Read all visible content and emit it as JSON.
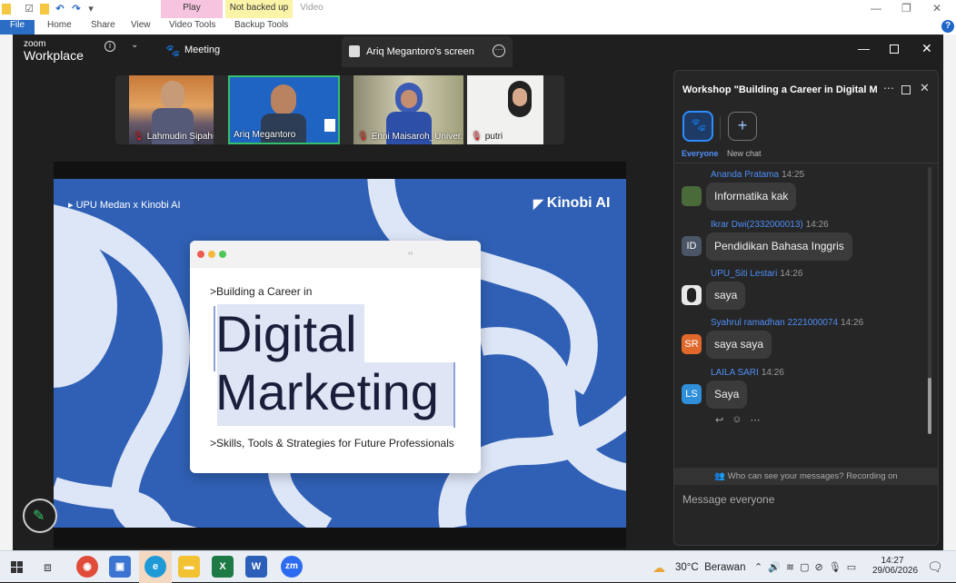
{
  "office": {
    "ribbon_contexts": [
      {
        "label": "Play",
        "color": "#f6c4df"
      },
      {
        "label": "Not backed up",
        "color": "#fbf3a8"
      },
      {
        "label": "Video",
        "color": "#ffffff"
      }
    ],
    "tabs": [
      "File",
      "Home",
      "Share",
      "View",
      "Video Tools",
      "Backup Tools"
    ]
  },
  "zoom": {
    "logo_small": "zoom",
    "logo_big": "Workplace",
    "meeting_label": "Meeting",
    "screen_tab_label": "Ariq Megantoro's screen"
  },
  "participants": [
    {
      "name": "Lahmudin Sipahutar ...",
      "muted": true
    },
    {
      "name": "Ariq Megantoro",
      "muted": false,
      "active": true
    },
    {
      "name": "Enni Maisaroh_Univer...",
      "muted": true
    },
    {
      "name": "putri",
      "muted": true
    }
  ],
  "slide": {
    "tag": "▸ UPU Medan x Kinobi AI",
    "brand": "Kinobi AI",
    "subtitle_top": ">Building a Career in",
    "title_line1": "Digital",
    "title_line2": "Marketing",
    "subtitle_bottom": ">Skills, Tools & Strategies for Future Professionals",
    "colors": {
      "background": "#3060b5",
      "stripe": "#dde6f7"
    }
  },
  "chat": {
    "title": "Workshop \"Building a Career in Digital Ma...",
    "everyone_label": "Everyone",
    "new_chat_label": "New chat",
    "notice": "Who can see your messages? Recording on",
    "input_placeholder": "Message everyone",
    "messages": [
      {
        "sender": "Ananda Pratama",
        "time": "14:25",
        "text": "Informatika kak",
        "avatar": "",
        "avatar_color": "#4a6a3a"
      },
      {
        "sender": "Ikrar Dwi(2332000013)",
        "time": "14:26",
        "text": "Pendidikan Bahasa Inggris",
        "avatar": "ID",
        "avatar_color": "#4a5566"
      },
      {
        "sender": "UPU_Siti Lestari",
        "time": "14:26",
        "text": "saya",
        "avatar": "",
        "avatar_color": "#e9e9e9"
      },
      {
        "sender": "Syahrul ramadhan 2221000074",
        "time": "14:26",
        "text": "saya saya",
        "avatar": "SR",
        "avatar_color": "#e0682a"
      },
      {
        "sender": "LAILA SARI",
        "time": "14:26",
        "text": "Saya",
        "avatar": "LS",
        "avatar_color": "#2f8fd8"
      }
    ]
  },
  "taskbar": {
    "weather": "30°C  Berawan",
    "time": "14:27",
    "date": "29/06/2026"
  }
}
